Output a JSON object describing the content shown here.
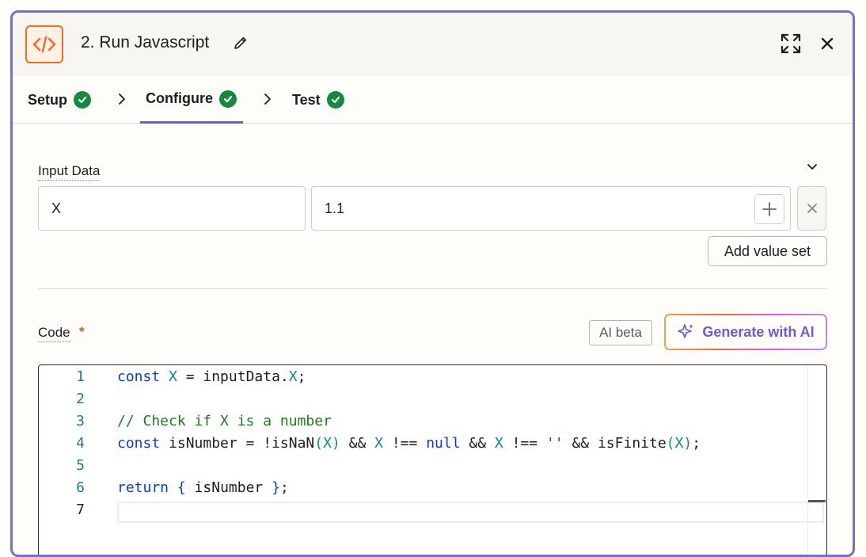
{
  "header": {
    "title": "2. Run Javascript",
    "icons": {
      "app": "code-icon",
      "edit": "pencil-icon",
      "expand": "expand-icon",
      "close": "close-icon"
    }
  },
  "tabs": [
    {
      "label": "Setup",
      "status": "complete"
    },
    {
      "label": "Configure",
      "status": "complete",
      "active": true
    },
    {
      "label": "Test",
      "status": "complete"
    }
  ],
  "input_data": {
    "label": "Input Data",
    "rows": [
      {
        "key": "X",
        "value": "1.1"
      }
    ],
    "add_value_set_label": "Add value set"
  },
  "code_section": {
    "label": "Code",
    "required_marker": "*",
    "ai_badge": "AI beta",
    "generate_label": "Generate with AI",
    "line_numbers": [
      "1",
      "2",
      "3",
      "4",
      "5",
      "6",
      "7"
    ],
    "lines": [
      "const X = inputData.X;",
      "",
      "// Check if X is a number",
      "const isNumber = !isNaN(X) && X !== null && X !== '' && isFinite(X);",
      "",
      "return { isNumber };",
      ""
    ]
  },
  "colors": {
    "accent": "#6c5bd6",
    "frame_border": "#7a6ad8",
    "check_green": "#138a40",
    "app_icon_orange": "#ff6a1a",
    "required": "#e0561a"
  }
}
